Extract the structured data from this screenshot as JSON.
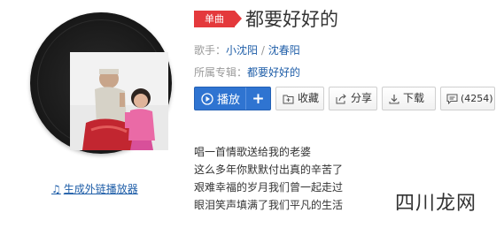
{
  "song": {
    "tag": "单曲",
    "title": "都要好好的",
    "singer_label": "歌手：",
    "singers": [
      "小沈阳",
      "沈春阳"
    ],
    "singer_sep": " / ",
    "album_label": "所属专辑：",
    "album": "都要好好的"
  },
  "actions": {
    "play": "播放",
    "add": "+",
    "collect": "收藏",
    "share": "分享",
    "download": "下载",
    "comments": "(4254)"
  },
  "cover": {
    "external_link": "生成外链播放器"
  },
  "lyrics": [
    "唱一首情歌送给我的老婆",
    "这么多年你默默付出真的辛苦了",
    "艰难幸福的岁月我们曾一起走过",
    "眼泪笑声填满了我们平凡的生活"
  ],
  "watermark": "四川龙网",
  "colors": {
    "accent_red": "#e4393c",
    "link_blue": "#1f5ea8",
    "play_blue": "#2f74d1"
  }
}
